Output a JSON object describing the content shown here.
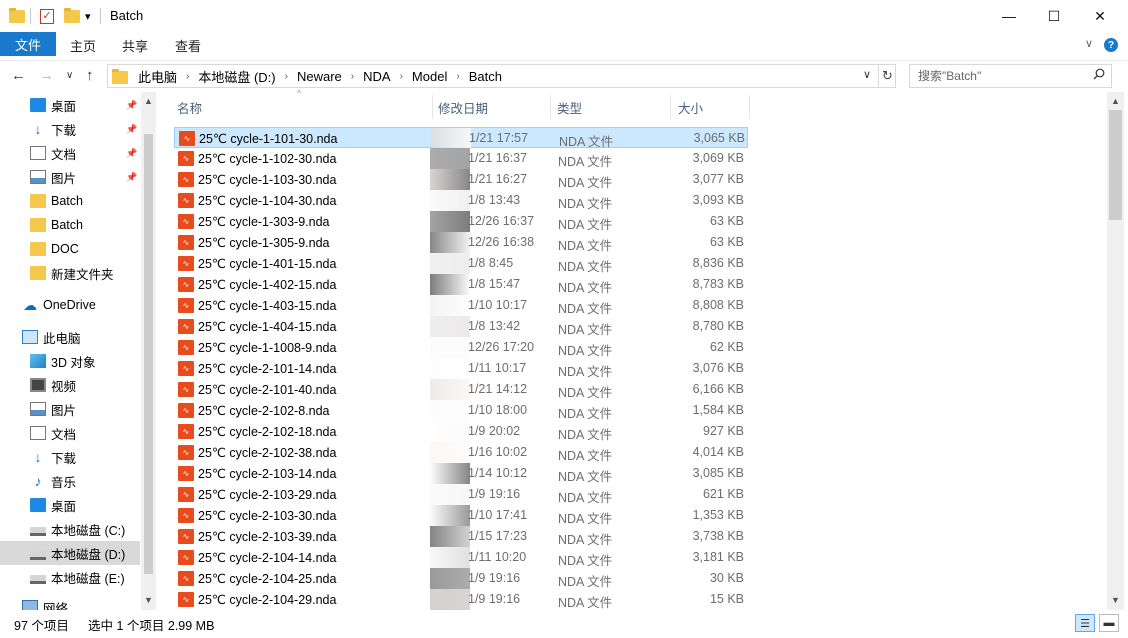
{
  "window": {
    "title": "Batch",
    "minimize_glyph": "—",
    "maximize_glyph": "☐",
    "close_glyph": "✕",
    "qa_dropdown_glyph": "▾"
  },
  "ribbon": {
    "file_tab": "文件",
    "tabs": [
      "主页",
      "共享",
      "查看"
    ],
    "expand_glyph": "∨",
    "help_glyph": "?"
  },
  "address": {
    "crumbs": [
      "此电脑",
      "本地磁盘 (D:)",
      "Neware",
      "NDA",
      "Model",
      "Batch"
    ],
    "back_glyph": "←",
    "forward_glyph": "→",
    "recent_glyph": "∨",
    "up_glyph": "↑",
    "dropdown_glyph": "∨",
    "refresh_glyph": "↻",
    "search_placeholder": "搜索\"Batch\""
  },
  "nav": {
    "items": [
      {
        "label": "桌面",
        "icon": "desktop-icon",
        "pinned": true
      },
      {
        "label": "下载",
        "icon": "download-icon",
        "pinned": true
      },
      {
        "label": "文档",
        "icon": "documents-icon",
        "pinned": true
      },
      {
        "label": "图片",
        "icon": "pictures-icon",
        "pinned": true
      },
      {
        "label": "Batch",
        "icon": "folder-icon"
      },
      {
        "label": "Batch",
        "icon": "folder-icon"
      },
      {
        "label": "DOC",
        "icon": "folder-icon"
      },
      {
        "label": "新建文件夹",
        "icon": "folder-icon"
      },
      {
        "label": "OneDrive",
        "icon": "onedrive-icon"
      },
      {
        "label": "此电脑",
        "icon": "this-pc-icon"
      },
      {
        "label": "3D 对象",
        "icon": "3d-objects-icon"
      },
      {
        "label": "视频",
        "icon": "videos-icon"
      },
      {
        "label": "图片",
        "icon": "pictures-icon"
      },
      {
        "label": "文档",
        "icon": "documents-icon"
      },
      {
        "label": "下载",
        "icon": "download-icon"
      },
      {
        "label": "音乐",
        "icon": "music-icon"
      },
      {
        "label": "桌面",
        "icon": "desktop-icon"
      },
      {
        "label": "本地磁盘 (C:)",
        "icon": "drive-icon"
      },
      {
        "label": "本地磁盘 (D:)",
        "icon": "drive-icon",
        "selected": true
      },
      {
        "label": "本地磁盘 (E:)",
        "icon": "drive-icon"
      },
      {
        "label": "网络",
        "icon": "network-icon"
      }
    ]
  },
  "columns": {
    "name": "名称",
    "date": "修改日期",
    "type": "类型",
    "size": "大小",
    "sort_glyph": "^"
  },
  "files": [
    {
      "name": "25℃ cycle-1-101-30.nda",
      "date": "1/21 17:57",
      "type": "NDA 文件",
      "size": "3,065 KB",
      "selected": true
    },
    {
      "name": "25℃ cycle-1-102-30.nda",
      "date": "1/21 16:37",
      "type": "NDA 文件",
      "size": "3,069 KB"
    },
    {
      "name": "25℃ cycle-1-103-30.nda",
      "date": "1/21 16:27",
      "type": "NDA 文件",
      "size": "3,077 KB"
    },
    {
      "name": "25℃ cycle-1-104-30.nda",
      "date": "1/8 13:43",
      "type": "NDA 文件",
      "size": "3,093 KB"
    },
    {
      "name": "25℃ cycle-1-303-9.nda",
      "date": "12/26 16:37",
      "type": "NDA 文件",
      "size": "63 KB"
    },
    {
      "name": "25℃ cycle-1-305-9.nda",
      "date": "12/26 16:38",
      "type": "NDA 文件",
      "size": "63 KB"
    },
    {
      "name": "25℃ cycle-1-401-15.nda",
      "date": "1/8 8:45",
      "type": "NDA 文件",
      "size": "8,836 KB"
    },
    {
      "name": "25℃ cycle-1-402-15.nda",
      "date": "1/8 15:47",
      "type": "NDA 文件",
      "size": "8,783 KB"
    },
    {
      "name": "25℃ cycle-1-403-15.nda",
      "date": "1/10 10:17",
      "type": "NDA 文件",
      "size": "8,808 KB"
    },
    {
      "name": "25℃ cycle-1-404-15.nda",
      "date": "1/8 13:42",
      "type": "NDA 文件",
      "size": "8,780 KB"
    },
    {
      "name": "25℃ cycle-1-1008-9.nda",
      "date": "12/26 17:20",
      "type": "NDA 文件",
      "size": "62 KB"
    },
    {
      "name": "25℃ cycle-2-101-14.nda",
      "date": "1/11 10:17",
      "type": "NDA 文件",
      "size": "3,076 KB"
    },
    {
      "name": "25℃ cycle-2-101-40.nda",
      "date": "1/21 14:12",
      "type": "NDA 文件",
      "size": "6,166 KB"
    },
    {
      "name": "25℃ cycle-2-102-8.nda",
      "date": "1/10 18:00",
      "type": "NDA 文件",
      "size": "1,584 KB"
    },
    {
      "name": "25℃ cycle-2-102-18.nda",
      "date": "1/9 20:02",
      "type": "NDA 文件",
      "size": "927 KB"
    },
    {
      "name": "25℃ cycle-2-102-38.nda",
      "date": "1/16 10:02",
      "type": "NDA 文件",
      "size": "4,014 KB"
    },
    {
      "name": "25℃ cycle-2-103-14.nda",
      "date": "1/14 10:12",
      "type": "NDA 文件",
      "size": "3,085 KB"
    },
    {
      "name": "25℃ cycle-2-103-29.nda",
      "date": "1/9 19:16",
      "type": "NDA 文件",
      "size": "621 KB"
    },
    {
      "name": "25℃ cycle-2-103-30.nda",
      "date": "1/10 17:41",
      "type": "NDA 文件",
      "size": "1,353 KB"
    },
    {
      "name": "25℃ cycle-2-103-39.nda",
      "date": "1/15 17:23",
      "type": "NDA 文件",
      "size": "3,738 KB"
    },
    {
      "name": "25℃ cycle-2-104-14.nda",
      "date": "1/11 10:20",
      "type": "NDA 文件",
      "size": "3,181 KB"
    },
    {
      "name": "25℃ cycle-2-104-25.nda",
      "date": "1/9 19:16",
      "type": "NDA 文件",
      "size": "30 KB"
    },
    {
      "name": "25℃ cycle-2-104-29.nda",
      "date": "1/9 19:16",
      "type": "NDA 文件",
      "size": "15 KB"
    }
  ],
  "status": {
    "item_count": "97 个项目",
    "selection": "选中 1 个项目  2.99 MB",
    "details_view_glyph": "☰",
    "tiles_view_glyph": "▬"
  },
  "colors": {
    "accent": "#1979ca",
    "selection": "#cce8ff",
    "file_icon": "#e84b1c"
  }
}
